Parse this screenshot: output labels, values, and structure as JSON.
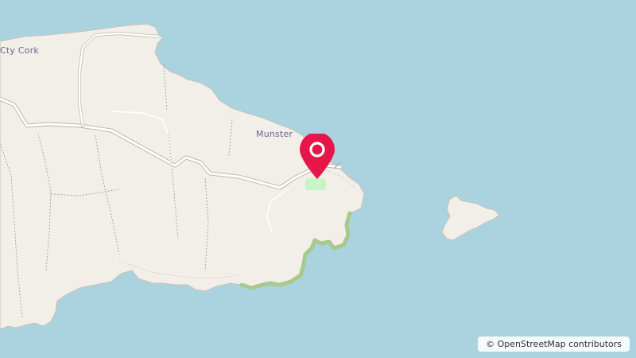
{
  "map": {
    "labels": {
      "county": "Cty Cork",
      "region": "Munster"
    },
    "attribution": "© OpenStreetMap contributors",
    "colors": {
      "water": "#aad3df",
      "land": "#f2efe9",
      "park": "#c8f5c8",
      "coast_vegetation": "#a8c98c",
      "road": "#ffffff",
      "marker": "#e4164a"
    },
    "marker_icon": "map-pin-icon"
  }
}
